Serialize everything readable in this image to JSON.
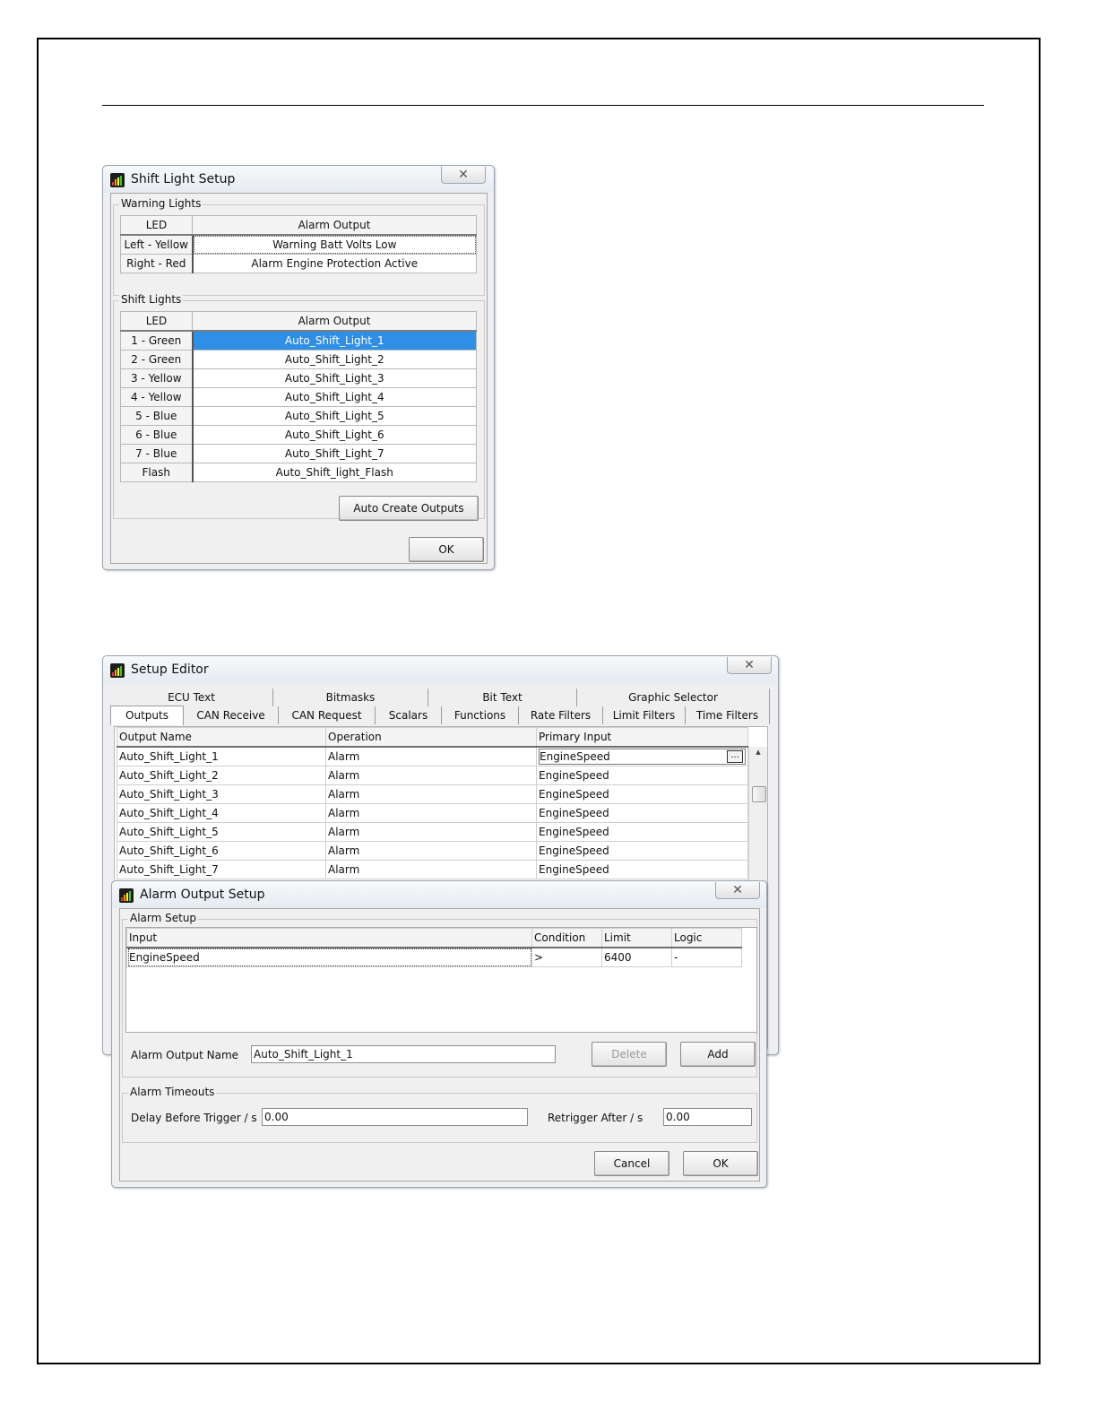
{
  "shift_light_dialog": {
    "title": "Shift Light Setup",
    "close_glyph": "✕",
    "warning_group_label": "Warning Lights",
    "warning_headers": [
      "LED",
      "Alarm Output"
    ],
    "warning_rows": [
      {
        "led": "Left - Yellow",
        "output": "Warning Batt Volts Low"
      },
      {
        "led": "Right - Red",
        "output": "Alarm Engine Protection Active"
      }
    ],
    "shift_group_label": "Shift Lights",
    "shift_headers": [
      "LED",
      "Alarm Output"
    ],
    "shift_rows": [
      {
        "led": "1 - Green",
        "output": "Auto_Shift_Light_1",
        "selected": true
      },
      {
        "led": "2 - Green",
        "output": "Auto_Shift_Light_2"
      },
      {
        "led": "3 - Yellow",
        "output": "Auto_Shift_Light_3"
      },
      {
        "led": "4 - Yellow",
        "output": "Auto_Shift_Light_4"
      },
      {
        "led": "5 - Blue",
        "output": "Auto_Shift_Light_5"
      },
      {
        "led": "6 - Blue",
        "output": "Auto_Shift_Light_6"
      },
      {
        "led": "7 - Blue",
        "output": "Auto_Shift_Light_7"
      },
      {
        "led": "Flash",
        "output": "Auto_Shift_light_Flash"
      }
    ],
    "auto_create_label": "Auto Create Outputs",
    "ok_label": "OK"
  },
  "setup_editor": {
    "title": "Setup Editor",
    "close_glyph": "✕",
    "tabs_row1": [
      "ECU Text",
      "Bitmasks",
      "Bit Text",
      "Graphic Selector"
    ],
    "tabs_row2": [
      "Outputs",
      "CAN Receive",
      "CAN Request",
      "Scalars",
      "Functions",
      "Rate Filters",
      "Limit Filters",
      "Time Filters"
    ],
    "active_tab": "Outputs",
    "columns": [
      "Output Name",
      "Operation",
      "Primary Input"
    ],
    "rows": [
      {
        "name": "Auto_Shift_Light_1",
        "operation": "Alarm",
        "input": "EngineSpeed"
      },
      {
        "name": "Auto_Shift_Light_2",
        "operation": "Alarm",
        "input": "EngineSpeed"
      },
      {
        "name": "Auto_Shift_Light_3",
        "operation": "Alarm",
        "input": "EngineSpeed"
      },
      {
        "name": "Auto_Shift_Light_4",
        "operation": "Alarm",
        "input": "EngineSpeed"
      },
      {
        "name": "Auto_Shift_Light_5",
        "operation": "Alarm",
        "input": "EngineSpeed"
      },
      {
        "name": "Auto_Shift_Light_6",
        "operation": "Alarm",
        "input": "EngineSpeed"
      },
      {
        "name": "Auto_Shift_Light_7",
        "operation": "Alarm",
        "input": "EngineSpeed"
      }
    ],
    "ellipsis_label": "...",
    "scroll_up_glyph": "▲"
  },
  "alarm_output_dialog": {
    "title": "Alarm Output Setup",
    "close_glyph": "✕",
    "alarm_setup_label": "Alarm Setup",
    "columns": [
      "Input",
      "Condition",
      "Limit",
      "Logic"
    ],
    "row": {
      "input": "EngineSpeed",
      "condition": ">",
      "limit": "6400",
      "logic": "-"
    },
    "name_label": "Alarm Output Name",
    "name_value": "Auto_Shift_Light_1",
    "delete_label": "Delete",
    "add_label": "Add",
    "timeouts_label": "Alarm Timeouts",
    "delay_label": "Delay Before Trigger / s",
    "delay_value": "0.00",
    "retrigger_label": "Retrigger After / s",
    "retrigger_value": "0.00",
    "cancel_label": "Cancel",
    "ok_label": "OK"
  },
  "colors": {
    "selection": "#2f8ee6",
    "window_bg": "#f0f0f0"
  }
}
